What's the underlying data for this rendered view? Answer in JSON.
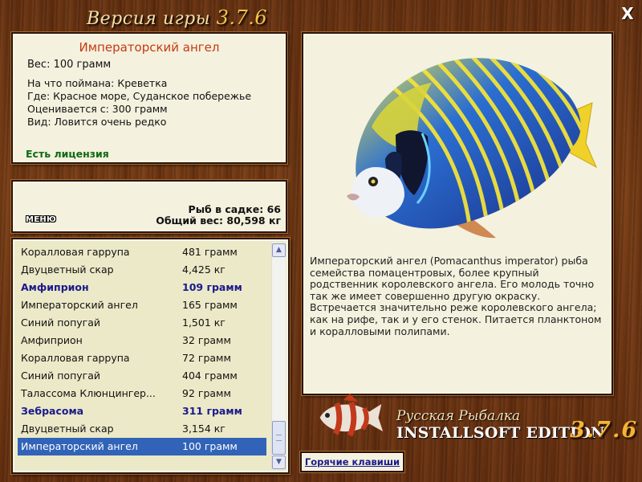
{
  "header": {
    "title": "Версия игры",
    "version": "3.7.6",
    "close": "X"
  },
  "fish_info": {
    "name": "Императорский ангел",
    "weight": "Вес: 100 грамм",
    "bait": "На что поймана: Креветка",
    "location": "Где: Красное море, Суданское побережье",
    "valued_from": "Оценивается с: 300 грамм",
    "type": "Вид: Ловится очень редко",
    "license": "Есть лицензия"
  },
  "stats": {
    "menu_label": "МЕНЮ",
    "fish_in_cage": "Рыб в садке: 66",
    "total_weight": "Общий вес: 80,598 кг"
  },
  "catch_list": [
    {
      "name": "Коралловая гаррупа",
      "weight": "481 грамм",
      "style": ""
    },
    {
      "name": "Двуцветный скар",
      "weight": "4,425 кг",
      "style": ""
    },
    {
      "name": "Амфиприон",
      "weight": "109 грамм",
      "style": "bold"
    },
    {
      "name": "Императорский ангел",
      "weight": "165 грамм",
      "style": ""
    },
    {
      "name": "Синий попугай",
      "weight": "1,501 кг",
      "style": ""
    },
    {
      "name": "Амфиприон",
      "weight": "32 грамм",
      "style": ""
    },
    {
      "name": "Коралловая гаррупа",
      "weight": "72 грамм",
      "style": ""
    },
    {
      "name": "Синий попугай",
      "weight": "404 грамм",
      "style": ""
    },
    {
      "name": "Талассома Клюнцингер...",
      "weight": "92 грамм",
      "style": ""
    },
    {
      "name": "Зебрасома",
      "weight": "311 грамм",
      "style": "bold"
    },
    {
      "name": "Двуцветный скар",
      "weight": "3,154 кг",
      "style": ""
    },
    {
      "name": "Императорский ангел",
      "weight": "100 грамм",
      "style": "sel"
    }
  ],
  "description": "Императорский ангел (Pomacanthus imperator) рыба семейства помацентровых, более крупный родственник королевского ангела. Его молодь точно так же имеет совершенно другую окраску. Встречается значительно реже королевского ангела; как на рифе, так и у его стенок. Питается планктоном и коралловыми полипами.",
  "logo": {
    "line1": "Русская Рыбалка",
    "line2": "INSTALLSOFT EDITION",
    "version": "3.7.6"
  },
  "hotkeys_label": "Горячие клавиши",
  "icons": {
    "scroll_up": "scroll-up-arrow",
    "scroll_down": "scroll-down-arrow",
    "close": "close-x"
  }
}
